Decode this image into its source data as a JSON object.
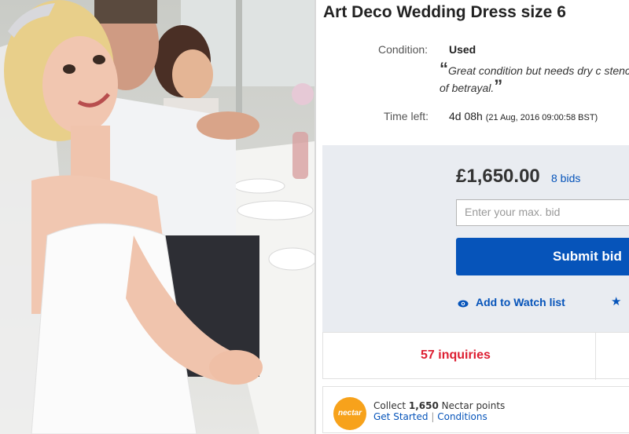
{
  "listing": {
    "title": "Art Deco Wedding Dress size 6",
    "condition_label": "Condition:",
    "condition_value": "Used",
    "condition_note_open": "“",
    "condition_note": "Great condition but needs dry c stench of betrayal.",
    "condition_note_close": "”",
    "time_left_label": "Time left:",
    "time_left_value": "4d 08h",
    "end_time": "(21 Aug, 2016   09:00:58 BST)"
  },
  "bid": {
    "price": "£1,650.00",
    "bid_count": "8 bids",
    "input_placeholder": "Enter your max. bid",
    "submit_label": "Submit bid",
    "watch_label": "Add to Watch list"
  },
  "inquiries": {
    "label": "57 inquiries"
  },
  "nectar": {
    "logo_text": "nectar",
    "collect_prefix": "Collect ",
    "points": "1,650",
    "collect_suffix": " Nectar points",
    "get_started": "Get Started",
    "conditions": "Conditions"
  },
  "colors": {
    "accent": "#0654ba",
    "inquiries": "#dd1e31",
    "bid_panel_bg": "#e9ecf1",
    "nectar_orange": "#f7a21b"
  },
  "icons": [
    "eye-icon",
    "star-icon"
  ]
}
